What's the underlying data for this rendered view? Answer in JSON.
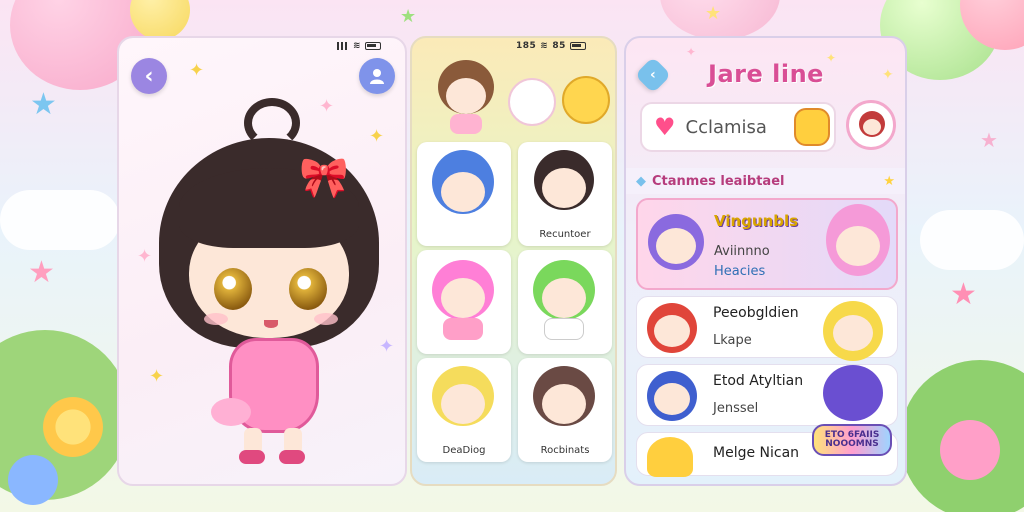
{
  "left_panel": {
    "status_text": "",
    "back_icon": "chevron-left-icon",
    "profile_icon": "user-icon"
  },
  "mid_panel": {
    "status_text": "185",
    "status_text_2": "85",
    "tiles": [
      {
        "label": ""
      },
      {
        "label": "Recuntoer"
      },
      {
        "label": ""
      },
      {
        "label": ""
      },
      {
        "label": "DeaDiog"
      },
      {
        "label": "Rocbinats"
      }
    ]
  },
  "right_panel": {
    "title": "Jare line",
    "search_text": "Cclamisa",
    "section_title": "Ctanmes leaibtael",
    "list": [
      {
        "title": "Vingunbls",
        "line2": "Aviinnno",
        "line3": "Heacies"
      },
      {
        "title": "Peeobgldien",
        "sub": "Lkape"
      },
      {
        "title": "Etod Atyltian",
        "sub": "Jenssel"
      },
      {
        "title": "Melge Nican"
      }
    ],
    "badge_text": "ETO 6FAIIS NOOOMNS"
  },
  "colors": {
    "accent_pink": "#d94e95",
    "back_button": "#9b86e2",
    "profile_button": "#7f93ea",
    "heart": "#ff4f8b"
  }
}
